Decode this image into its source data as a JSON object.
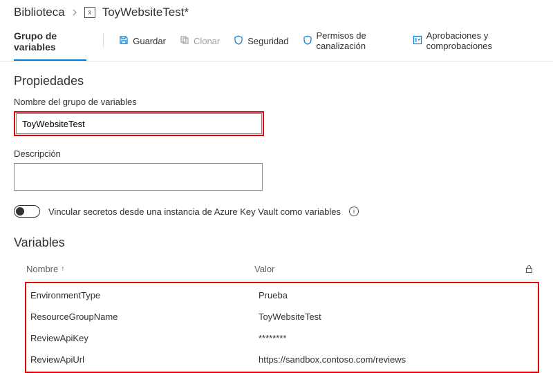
{
  "breadcrumb": {
    "parent": "Biblioteca",
    "current": "ToyWebsiteTest*"
  },
  "tabs": {
    "variable_group": "Grupo de variables"
  },
  "toolbar": {
    "save": "Guardar",
    "clone": "Clonar",
    "security": "Seguridad",
    "pipeline_permissions": "Permisos de canalización",
    "approvals_checks": "Aprobaciones y comprobaciones"
  },
  "properties": {
    "heading": "Propiedades",
    "name_label": "Nombre del grupo de variables",
    "name_value": "ToyWebsiteTest",
    "description_label": "Descripción",
    "description_value": "",
    "keyvault_toggle_label": "Vincular secretos desde una instancia de Azure Key Vault como variables"
  },
  "variables": {
    "heading": "Variables",
    "col_name": "Nombre",
    "col_value": "Valor",
    "rows": [
      {
        "name": "EnvironmentType",
        "value": "Prueba"
      },
      {
        "name": "ResourceGroupName",
        "value": "ToyWebsiteTest"
      },
      {
        "name": "ReviewApiKey",
        "value": "********"
      },
      {
        "name": "ReviewApiUrl",
        "value": "https://sandbox.contoso.com/reviews"
      }
    ]
  }
}
